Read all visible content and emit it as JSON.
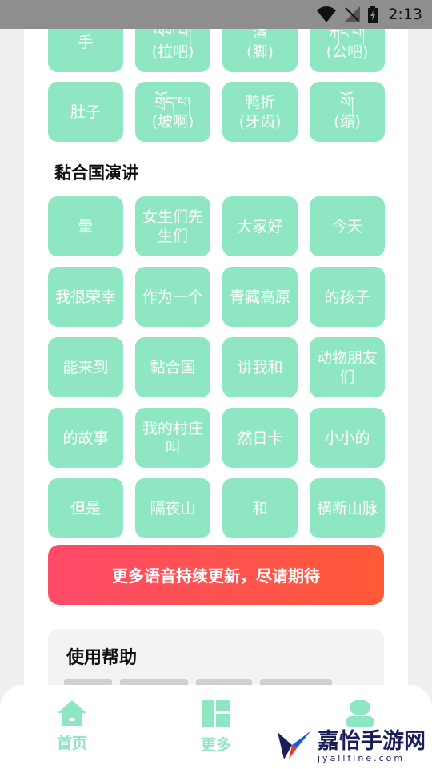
{
  "status_bar": {
    "time": "2:13"
  },
  "row_top": [
    "手",
    "ལག་པ།\n(拉吧)",
    "酒\n(脚)",
    "རྐང་པ།\n(公吧)"
  ],
  "row_second": [
    "肚子",
    "གྲོད་པ།\n(坡啊)",
    "鸭折\n(牙齿)",
    "སོ།\n(缩)"
  ],
  "section": {
    "title": "黏合国演讲"
  },
  "speech_rows": [
    [
      "暈",
      "女生们先生们",
      "大家好",
      "今天"
    ],
    [
      "我很荣幸",
      "作为一个",
      "青藏高原",
      "的孩子"
    ],
    [
      "能来到",
      "黏合国",
      "讲我和",
      "动物朋友们"
    ],
    [
      "的故事",
      "我的村庄叫",
      "然日卡",
      "小小的"
    ],
    [
      "但是",
      "隔夜山",
      "和",
      "横断山脉"
    ]
  ],
  "banner": {
    "label": "更多语音持续更新，尽请期待"
  },
  "help": {
    "title": "使用帮助"
  },
  "nav": {
    "home_label": "首页",
    "more_label": "更多"
  },
  "watermark": {
    "cn": "嘉怡手游网",
    "en": "jyallfine.com"
  },
  "colors": {
    "tile": "#8fe6c3",
    "banner_start": "#ff4a6a",
    "banner_end": "#ff5a38"
  }
}
